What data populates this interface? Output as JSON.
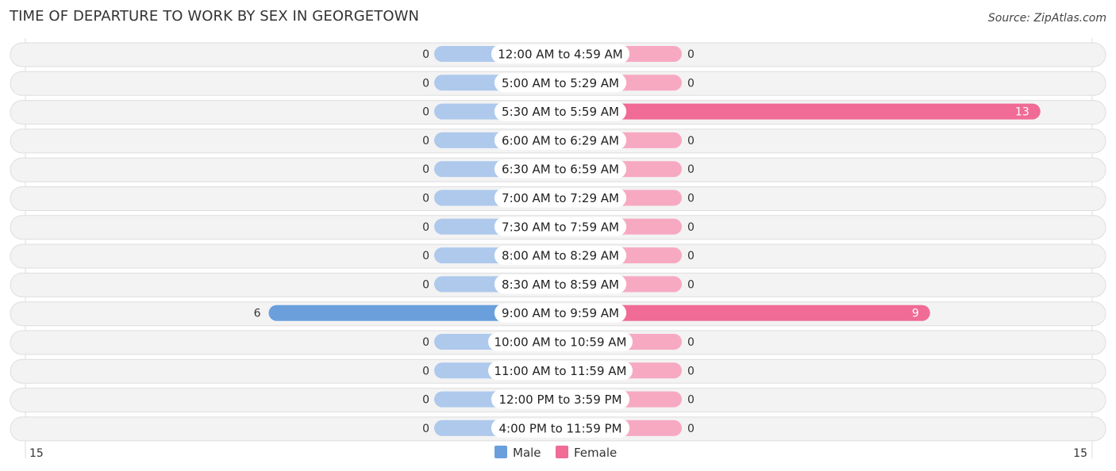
{
  "title": "TIME OF DEPARTURE TO WORK BY SEX IN GEORGETOWN",
  "source": "Source: ZipAtlas.com",
  "chart_data": {
    "type": "bar",
    "orientation": "horizontal-diverging",
    "title": "TIME OF DEPARTURE TO WORK BY SEX IN GEORGETOWN",
    "categories": [
      "12:00 AM to 4:59 AM",
      "5:00 AM to 5:29 AM",
      "5:30 AM to 5:59 AM",
      "6:00 AM to 6:29 AM",
      "6:30 AM to 6:59 AM",
      "7:00 AM to 7:29 AM",
      "7:30 AM to 7:59 AM",
      "8:00 AM to 8:29 AM",
      "8:30 AM to 8:59 AM",
      "9:00 AM to 9:59 AM",
      "10:00 AM to 10:59 AM",
      "11:00 AM to 11:59 AM",
      "12:00 PM to 3:59 PM",
      "4:00 PM to 11:59 PM"
    ],
    "series": [
      {
        "name": "Male",
        "color": "#6a9fdc",
        "light_color": "#aec9ec",
        "values": [
          0,
          0,
          0,
          0,
          0,
          0,
          0,
          0,
          0,
          6,
          0,
          0,
          0,
          0
        ]
      },
      {
        "name": "Female",
        "color": "#f06b96",
        "light_color": "#f7a9c2",
        "values": [
          0,
          0,
          13,
          0,
          0,
          0,
          0,
          0,
          0,
          9,
          0,
          0,
          0,
          0
        ]
      }
    ],
    "axis": {
      "left_tick": "15",
      "right_tick": "15",
      "range": [
        -15,
        15
      ]
    },
    "legend": {
      "position": "bottom-center",
      "items": [
        "Male",
        "Female"
      ]
    }
  }
}
